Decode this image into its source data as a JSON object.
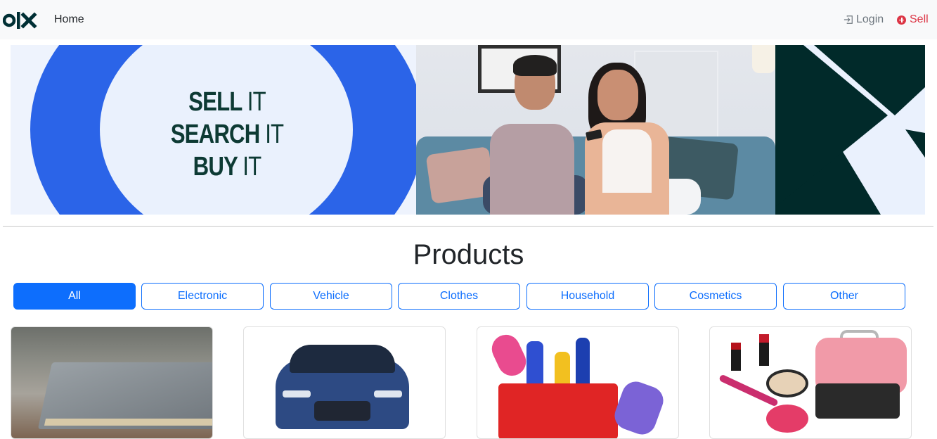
{
  "navbar": {
    "logo_text": "OLX",
    "home_label": "Home",
    "login_label": "Login",
    "sell_label": "Sell"
  },
  "banner": {
    "slogan_lines": [
      {
        "bold": "SELL",
        "light": "IT"
      },
      {
        "bold": "SEARCH",
        "light": "IT"
      },
      {
        "bold": "BUY",
        "light": "IT"
      }
    ]
  },
  "products": {
    "title": "Products",
    "filters": [
      {
        "label": "All",
        "active": true
      },
      {
        "label": "Electronic",
        "active": false
      },
      {
        "label": "Vehicle",
        "active": false
      },
      {
        "label": "Clothes",
        "active": false
      },
      {
        "label": "Household",
        "active": false
      },
      {
        "label": "Cosmetics",
        "active": false
      },
      {
        "label": "Other",
        "active": false
      }
    ],
    "cards": [
      {
        "image": "laptop"
      },
      {
        "image": "car"
      },
      {
        "image": "household-cleaning-supplies"
      },
      {
        "image": "cosmetics"
      }
    ]
  },
  "colors": {
    "primary": "#0d6efd",
    "sell": "#dc3545",
    "banner_blue": "#2b64e8",
    "banner_dark": "#012a2a",
    "slogan": "#0d3a34"
  }
}
